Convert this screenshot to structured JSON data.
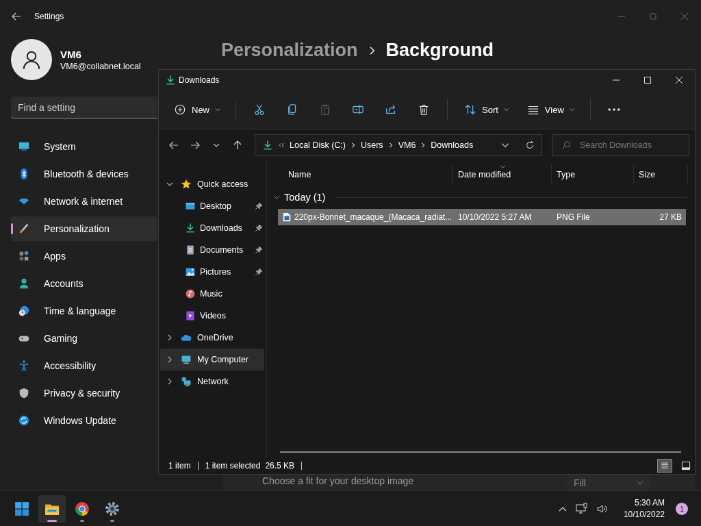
{
  "settings": {
    "title": "Settings",
    "user": {
      "name": "VM6",
      "email": "VM6@collabnet.local"
    },
    "search": {
      "placeholder": "Find a setting"
    },
    "nav": [
      {
        "label": "System",
        "kind": "system",
        "selected": false
      },
      {
        "label": "Bluetooth & devices",
        "kind": "bluetooth",
        "selected": false
      },
      {
        "label": "Network & internet",
        "kind": "wifi",
        "selected": false
      },
      {
        "label": "Personalization",
        "kind": "brush",
        "selected": true
      },
      {
        "label": "Apps",
        "kind": "apps",
        "selected": false
      },
      {
        "label": "Accounts",
        "kind": "person",
        "selected": false
      },
      {
        "label": "Time & language",
        "kind": "clock",
        "selected": false
      },
      {
        "label": "Gaming",
        "kind": "gamepad",
        "selected": false
      },
      {
        "label": "Accessibility",
        "kind": "accessibility",
        "selected": false
      },
      {
        "label": "Privacy & security",
        "kind": "shield",
        "selected": false
      },
      {
        "label": "Windows Update",
        "kind": "update",
        "selected": false
      }
    ],
    "breadcrumb": [
      {
        "label": "Personalization",
        "current": false
      },
      {
        "label": "Background",
        "current": true
      }
    ],
    "fit_setting": {
      "label": "Choose a fit for your desktop image",
      "value": "Fill"
    }
  },
  "explorer": {
    "title": "Downloads",
    "toolbar": [
      [
        {
          "kind": "new",
          "label": "New",
          "disabled": false
        }
      ],
      [
        {
          "kind": "cut",
          "disabled": false
        },
        {
          "kind": "copy",
          "disabled": false
        },
        {
          "kind": "paste",
          "disabled": true
        },
        {
          "kind": "rename",
          "disabled": false
        },
        {
          "kind": "share",
          "disabled": false
        },
        {
          "kind": "delete",
          "disabled": false
        }
      ],
      [
        {
          "kind": "sort",
          "label": "Sort",
          "disabled": false
        },
        {
          "kind": "view",
          "label": "View",
          "disabled": false
        }
      ],
      [
        {
          "kind": "more",
          "disabled": false
        }
      ]
    ],
    "address": [
      "Local Disk (C:)",
      "Users",
      "VM6",
      "Downloads"
    ],
    "search": {
      "placeholder": "Search Downloads"
    },
    "tree": [
      {
        "label": "Quick access",
        "kind": "star",
        "expanded": true,
        "selected": false,
        "children": [
          {
            "label": "Desktop",
            "kind": "desktop",
            "pinned": true,
            "selected": false
          },
          {
            "label": "Downloads",
            "kind": "download",
            "pinned": true,
            "selected": false
          },
          {
            "label": "Documents",
            "kind": "document",
            "pinned": true,
            "selected": false
          },
          {
            "label": "Pictures",
            "kind": "pictures",
            "pinned": true,
            "selected": false
          },
          {
            "label": "Music",
            "kind": "music",
            "pinned": false,
            "selected": false
          },
          {
            "label": "Videos",
            "kind": "videos",
            "pinned": false,
            "selected": false
          }
        ]
      },
      {
        "label": "OneDrive",
        "kind": "cloud",
        "expanded": false,
        "selected": false
      },
      {
        "label": "My Computer",
        "kind": "computer",
        "expanded": false,
        "selected": true
      },
      {
        "label": "Network",
        "kind": "network",
        "expanded": false,
        "selected": false
      }
    ],
    "columns": [
      {
        "label": "Name",
        "sorted": false
      },
      {
        "label": "Date modified",
        "sorted": true
      },
      {
        "label": "Type",
        "sorted": false
      },
      {
        "label": "Size",
        "sorted": false
      }
    ],
    "groups": [
      {
        "label": "Today (1)",
        "expanded": true,
        "rows": [
          {
            "name": "220px-Bonnet_macaque_(Macaca_radiat...",
            "date": "10/10/2022 5:27 AM",
            "type": "PNG File",
            "size": "27 KB",
            "selected": true
          }
        ]
      }
    ],
    "status": {
      "count": "1 item",
      "selection": "1 item selected",
      "size": "26.5 KB"
    },
    "view_buttons": [
      {
        "kind": "details",
        "selected": true
      },
      {
        "kind": "tiles",
        "selected": false
      }
    ]
  },
  "taskbar": {
    "apps": [
      {
        "kind": "start",
        "selected": false,
        "running": false
      },
      {
        "kind": "explorer",
        "selected": true,
        "running": true
      },
      {
        "kind": "chrome",
        "selected": false,
        "running": true
      },
      {
        "kind": "settings",
        "selected": false,
        "running": true
      }
    ],
    "time": "5:30 AM",
    "date": "10/10/2022",
    "notifications": "1"
  }
}
